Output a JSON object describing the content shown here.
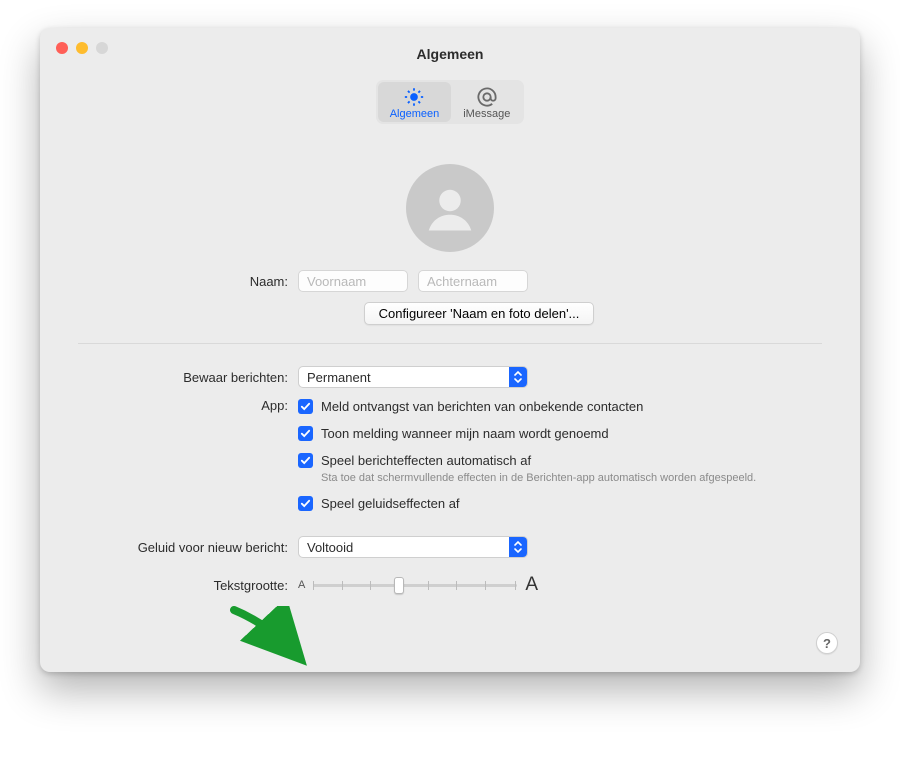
{
  "window": {
    "title": "Algemeen"
  },
  "tabs": {
    "general": "Algemeen",
    "imessage": "iMessage"
  },
  "profile": {
    "name_label": "Naam:",
    "first_placeholder": "Voornaam",
    "last_placeholder": "Achternaam",
    "configure_button": "Configureer 'Naam en foto delen'..."
  },
  "keep_messages": {
    "label": "Bewaar berichten:",
    "value": "Permanent"
  },
  "app": {
    "label": "App:",
    "opt1": "Meld ontvangst van berichten van onbekende contacten",
    "opt2": "Toon melding wanneer mijn naam wordt genoemd",
    "opt3": "Speel berichteffecten automatisch af",
    "opt3_sub": "Sta toe dat schermvullende effecten in de Berichten-app automatisch worden afgespeeld.",
    "opt4": "Speel geluidseffecten af"
  },
  "sound": {
    "label": "Geluid voor nieuw bericht:",
    "value": "Voltooid"
  },
  "textsize": {
    "label": "Tekstgrootte:",
    "small": "A",
    "large": "A"
  },
  "help": "?"
}
